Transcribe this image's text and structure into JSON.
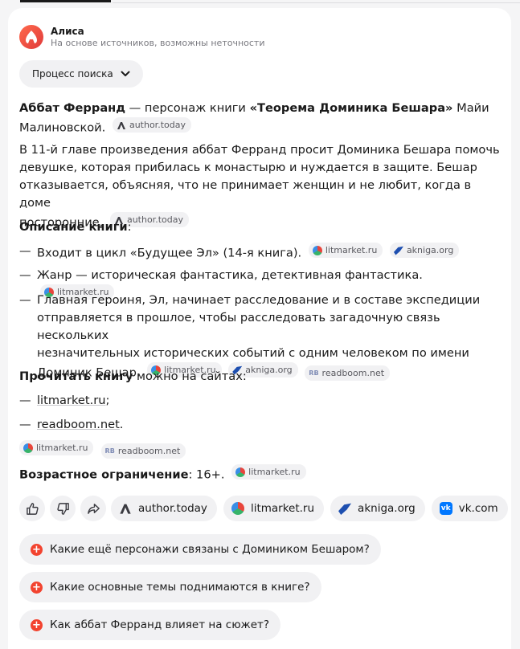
{
  "assistant": {
    "name": "Алиса",
    "subtitle": "На основе источников, возможны неточности"
  },
  "search_process": {
    "label": "Процесс поиска"
  },
  "intro": {
    "subject": "Аббат Ферранд",
    "middle": " — персонаж книги ",
    "book": "«Теорема Доминика Бешара»",
    "author_line1": " Майи",
    "author_line2": "Малиновской.",
    "source": "author.today"
  },
  "summary": {
    "line1": "В 11-й главе произведения аббат Ферранд просит Доминика Бешара помочь",
    "line2": "девушке, которая прибилась к монастырю и нуждается в защите. Бешар",
    "line3": "отказывается, объясняя, что не принимает женщин и не любит, когда в доме",
    "line4": "посторонние.",
    "source": "author.today"
  },
  "description": {
    "heading": "Описание книги",
    "colon": ":",
    "items": [
      {
        "text": "Входит в цикл «Будущее Эл» (14-я книга).",
        "sources": [
          "litmarket.ru",
          "akniga.org"
        ]
      },
      {
        "text": "Жанр — историческая фантастика, детективная фантастика.",
        "sources": [
          "litmarket.ru"
        ]
      },
      {
        "lines": [
          "Главная героиня, Эл, начинает расследование и в составе экспедиции",
          "отправляется в прошлое, чтобы расследовать загадочную связь нескольких",
          "незначительных исторических событий с одним человеком по имени",
          "Доминик Бешар."
        ],
        "sources": [
          "litmarket.ru",
          "akniga.org",
          "readboom.net"
        ]
      }
    ]
  },
  "read": {
    "heading": "Прочитать книгу",
    "rest": " можно на сайтах:",
    "links": [
      "litmarket.ru",
      "readboom.net"
    ],
    "link_suffixes": [
      ";",
      "."
    ],
    "sources": [
      "litmarket.ru",
      "readboom.net"
    ]
  },
  "age": {
    "heading": "Возрастное ограничение",
    "value": ": 16+.",
    "source": "litmarket.ru"
  },
  "source_buttons": [
    "author.today",
    "litmarket.ru",
    "akniga.org",
    "vk.com"
  ],
  "suggestions": [
    "Какие ещё персонажи связаны с Домиником Бешаром?",
    "Какие основные темы поднимаются в книге?",
    "Как аббат Ферранд влияет на сюжет?"
  ],
  "colors": {
    "accent": "#f2432f",
    "chip_bg": "#f1f1f3",
    "vk": "#0077ff"
  },
  "misc": {
    "dash": "—",
    "rb_mark": "RB"
  }
}
